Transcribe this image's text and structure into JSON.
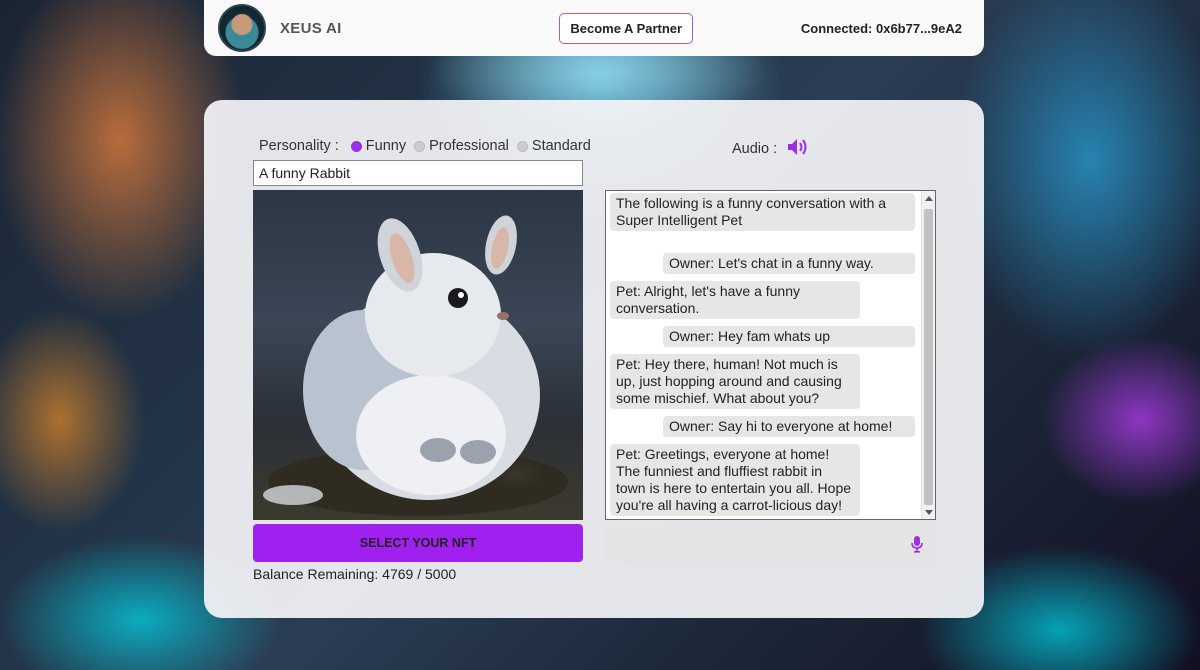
{
  "header": {
    "brand": "XEUS AI",
    "partner_button": "Become A Partner",
    "connected": "Connected: 0x6b77...9eA2"
  },
  "personality": {
    "label": "Personality :",
    "options": [
      "Funny",
      "Professional",
      "Standard"
    ],
    "selected": "Funny"
  },
  "prompt": {
    "value": "A funny Rabbit"
  },
  "nft_button": "SELECT YOUR NFT",
  "balance": "Balance Remaining: 4769 / 5000",
  "audio": {
    "label": "Audio :",
    "icon": "speaker-icon"
  },
  "chat": {
    "messages": [
      {
        "role": "intro",
        "text": "The following is a funny conversation with a Super Intelligent Pet"
      },
      {
        "role": "owner",
        "text": "Owner: Let's chat in a funny way."
      },
      {
        "role": "pet",
        "text": "Pet: Alright, let's have a funny conversation."
      },
      {
        "role": "owner",
        "text": "Owner: Hey fam whats up"
      },
      {
        "role": "pet",
        "text": "Pet: Hey there, human! Not much is up, just hopping around and causing some mischief. What about you?"
      },
      {
        "role": "owner",
        "text": "Owner: Say hi to everyone at home!"
      },
      {
        "role": "pet",
        "text": "Pet: Greetings, everyone at home! The funniest and fluffiest rabbit in town is here to entertain you all. Hope you're all having a carrot-licious day!"
      }
    ],
    "input_icon": "microphone-icon"
  },
  "colors": {
    "accent": "#a020f0",
    "radio_on": "#9b2ee6"
  }
}
